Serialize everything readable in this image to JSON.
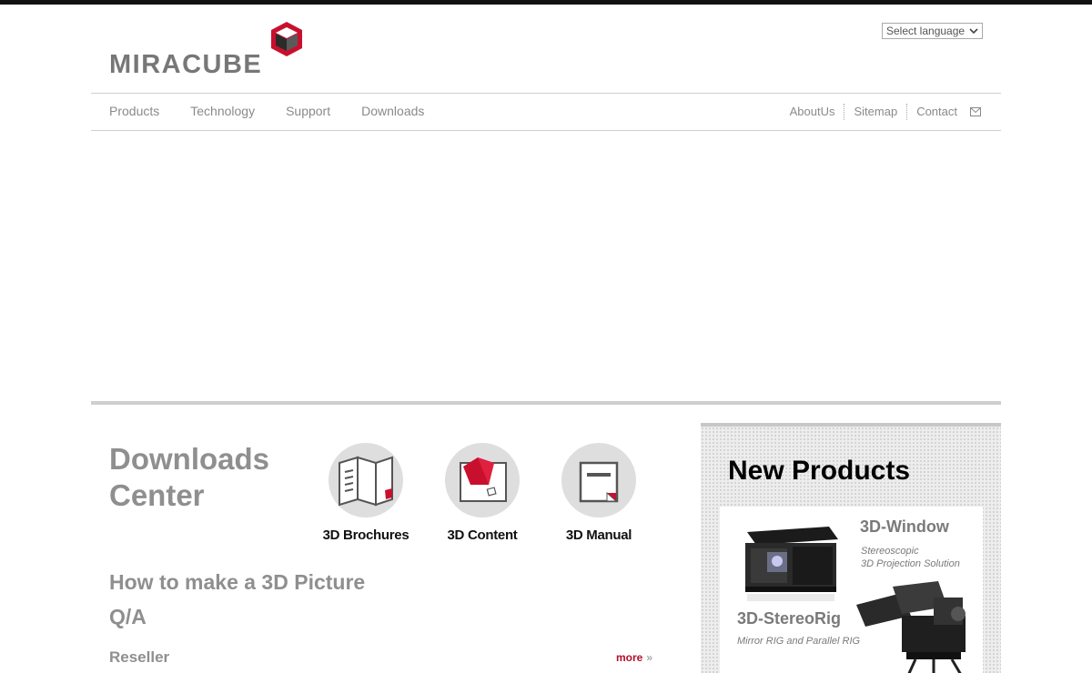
{
  "brand": {
    "name": "MIRACUBE",
    "accent": "#c8102e",
    "logo_gray": "#77777a"
  },
  "language_select": {
    "selected": "Select language"
  },
  "nav": {
    "left": [
      "Products",
      "Technology",
      "Support",
      "Downloads"
    ],
    "right": [
      "AboutUs",
      "Sitemap",
      "Contact"
    ]
  },
  "downloads": {
    "title_line1": "Downloads",
    "title_line2": "Center",
    "items": [
      {
        "label": "3D Brochures",
        "icon": "brochure-icon"
      },
      {
        "label": "3D Content",
        "icon": "cube-content-icon"
      },
      {
        "label": "3D Manual",
        "icon": "manual-icon"
      }
    ],
    "how_to": "How to make a 3D Picture",
    "qa": "Q/A",
    "reseller": "Reseller",
    "more": "more"
  },
  "new_products": {
    "title": "New Products",
    "products": [
      {
        "name": "3D-Window",
        "desc_line1": "Stereoscopic",
        "desc_line2": "3D Projection Solution"
      },
      {
        "name": "3D-StereoRig",
        "desc": "Mirror RIG and Parallel RIG"
      }
    ]
  }
}
